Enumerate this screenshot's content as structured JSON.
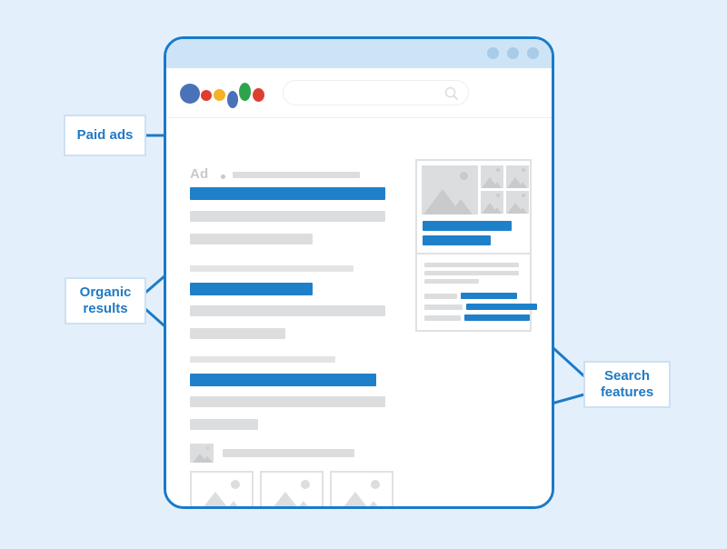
{
  "background_color": "#e3f0fb",
  "accent_blue": "#1f80ca",
  "border_blue": "#1a7ac9",
  "skeleton_gray": "#dcdddf",
  "callout_border": "#cde0f3",
  "browser": {
    "titlebar": {
      "color": "#cde4f7",
      "window_dots": [
        "window-dot-1",
        "window-dot-2",
        "window-dot-3"
      ],
      "dot_color": "#a8cbe8"
    },
    "logo": {
      "name": "google-logo",
      "blobs": [
        {
          "color": "#4a72b8",
          "shape": "circle"
        },
        {
          "color": "#dd3e32",
          "shape": "circle"
        },
        {
          "color": "#f6b124",
          "shape": "circle"
        },
        {
          "color": "#4a72b8",
          "shape": "ellipse"
        },
        {
          "color": "#2ea24d",
          "shape": "ellipse"
        },
        {
          "color": "#dd3e32",
          "shape": "circle"
        }
      ]
    },
    "search": {
      "placeholder": "",
      "value": "",
      "icon": "search-icon"
    }
  },
  "serp": {
    "ad_block": {
      "label": "Ad",
      "separator_dot": true,
      "url_bar_width": 140,
      "title_width": 215,
      "description_lines": [
        215,
        135
      ]
    },
    "organic_results": [
      {
        "url_width": 180,
        "title_width": 135,
        "description_lines": [
          215,
          105
        ]
      },
      {
        "url_width": 160,
        "title_width": 205,
        "description_lines": [
          215,
          75
        ]
      }
    ],
    "image_pack": {
      "header_icon": "image-placeholder-icon",
      "header_bar_width": 145,
      "thumbnails": [
        "image-thumb-1",
        "image-thumb-2",
        "image-thumb-3"
      ],
      "pagination": {
        "arrow": "arrow-right-icon",
        "active_indicator": true
      }
    },
    "knowledge_panel": {
      "hero_image": "knowledge-hero-image",
      "thumbnails": [
        "kp-thumb-1",
        "kp-thumb-2",
        "kp-thumb-3",
        "kp-thumb-4"
      ],
      "action_bars": [
        98,
        75
      ],
      "text_lines": [
        104,
        104,
        60
      ],
      "attribute_rows": [
        {
          "label_width": 36,
          "value_width": 62
        },
        {
          "label_width": 42,
          "value_width": 78
        },
        {
          "label_width": 40,
          "value_width": 72
        }
      ]
    }
  },
  "callouts": [
    {
      "id": "paid-ads",
      "label": "Paid ads",
      "lines": [
        "Paid ads"
      ]
    },
    {
      "id": "organic-results",
      "label": "Organic results",
      "lines": [
        "Organic",
        "results"
      ]
    },
    {
      "id": "search-features",
      "label": "Search features",
      "lines": [
        "Search",
        "features"
      ]
    }
  ]
}
